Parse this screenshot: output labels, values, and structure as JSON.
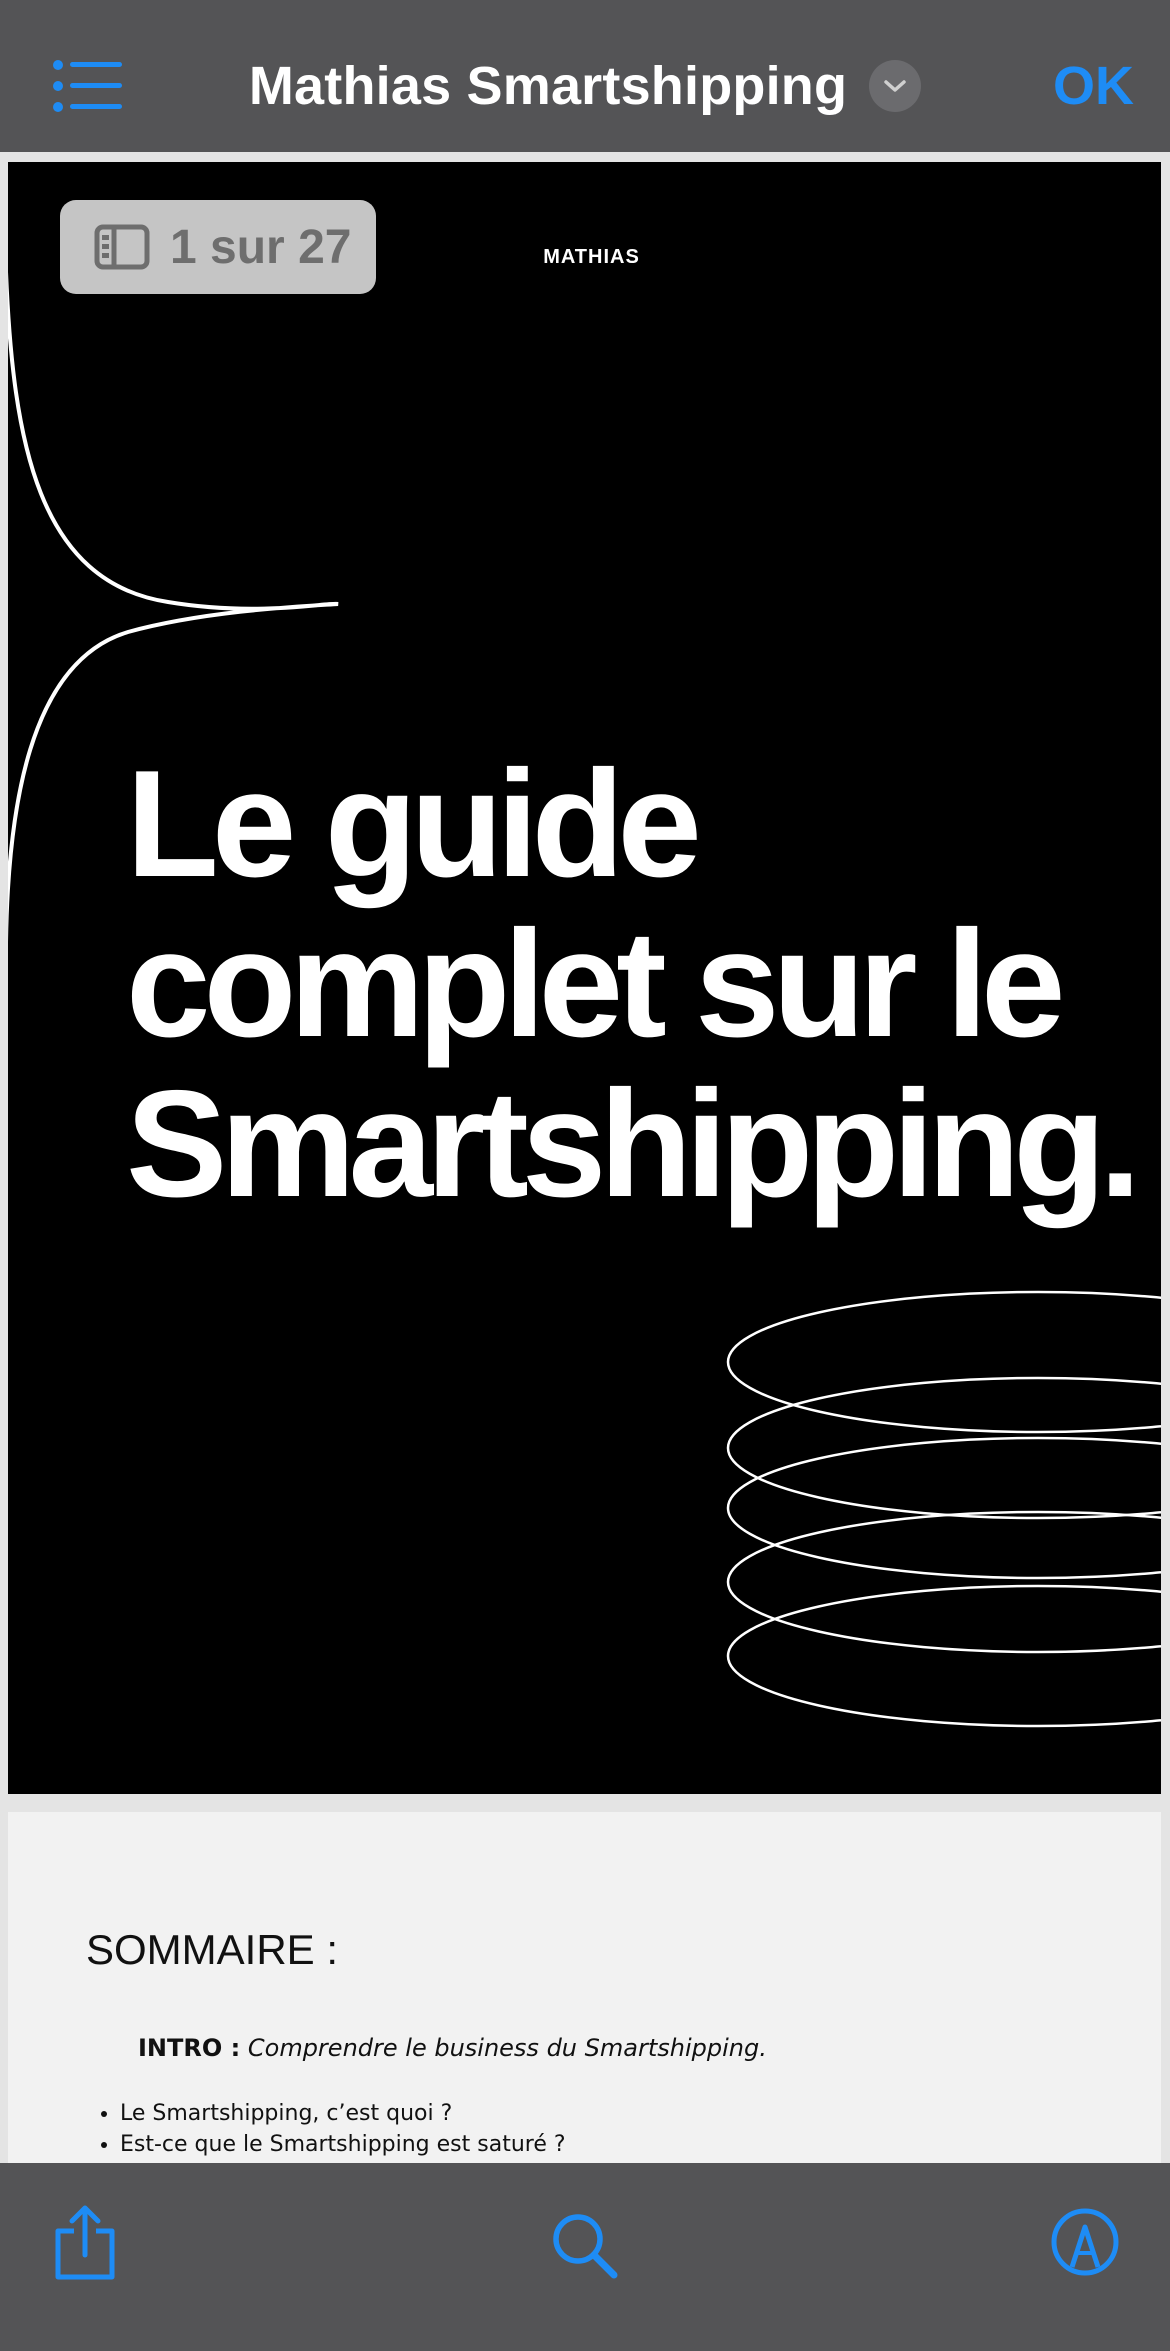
{
  "nav": {
    "title": "Mathias Smartshipping",
    "done_label": "OK"
  },
  "page1": {
    "page_indicator": "1 sur 27",
    "brand": "MATHIAS",
    "headline": [
      "Le guide",
      "complet sur le",
      "Smartshipping."
    ]
  },
  "page2": {
    "heading": "SOMMAIRE :",
    "intro_label": "INTRO :",
    "intro_text": "Comprendre le business du Smartshipping.",
    "items": [
      "Le Smartshipping, c’est quoi ?",
      "Est-ce que le Smartshipping est saturé ?"
    ]
  },
  "icons": {
    "menu": "list-icon",
    "dropdown": "chevron-down-icon",
    "thumbnails": "sidebar-icon",
    "share": "share-icon",
    "search": "search-icon",
    "markup": "markup-pen-icon"
  },
  "colors": {
    "accent": "#1e8cf5",
    "bar": "#545456",
    "badge": "#c5c5c5"
  }
}
